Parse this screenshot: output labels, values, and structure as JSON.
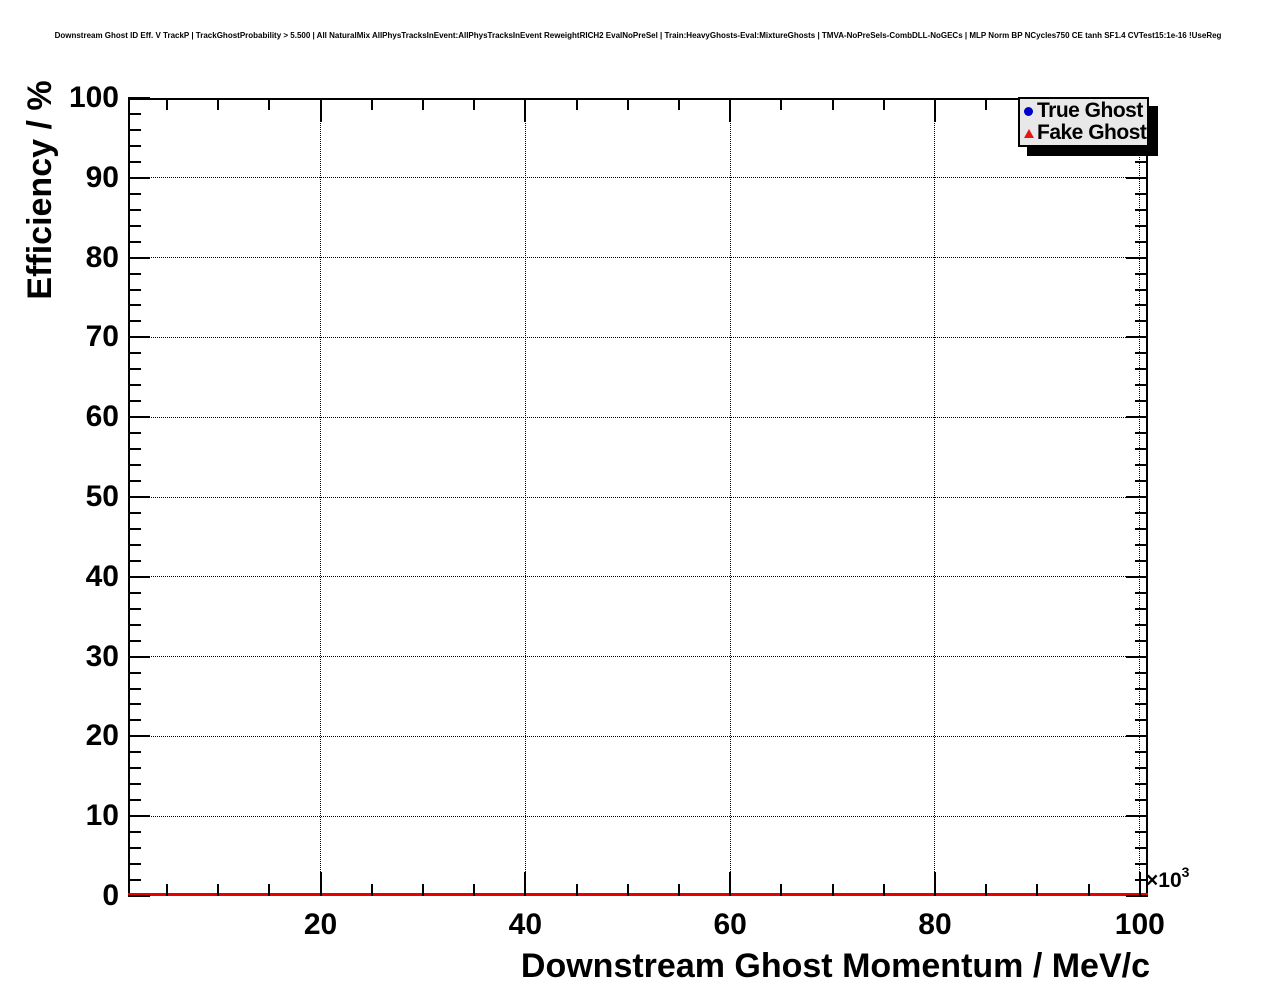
{
  "chart_data": {
    "type": "scatter",
    "title": "Downstream Ghost ID Eff. V TrackP | TrackGhostProbability > 5.500 | All NaturalMix AllPhysTracksInEvent:AllPhysTracksInEvent ReweightRICH2 EvalNoPreSel | Train:HeavyGhosts-Eval:MixtureGhosts | TMVA-NoPreSels-CombDLL-NoGECs | MLP Norm BP NCycles750 CE tanh SF1.4 CVTest15:1e-16 !UseReg",
    "xlabel": "Downstream Ghost Momentum / MeV/c",
    "ylabel": "Efficiency / %",
    "x_multiplier_base": "×10",
    "x_multiplier_exp": "3",
    "xlim": [
      1.2,
      100.8
    ],
    "ylim": [
      0,
      100
    ],
    "x_major_ticks": [
      20,
      40,
      60,
      80,
      100
    ],
    "x_minor_tick_step": 5,
    "y_major_ticks": [
      0,
      10,
      20,
      30,
      40,
      50,
      60,
      70,
      80,
      90,
      100
    ],
    "y_minor_tick_step": 2,
    "grid": {
      "style": "dotted",
      "color": "#000000",
      "at_major_ticks": true
    },
    "frame_color": "#000000",
    "background_color": "#ffffff",
    "legend": {
      "position": "top-right",
      "fill_color": "#e8e8e8",
      "border_color": "#000000",
      "shadow": true,
      "entries": [
        {
          "label": "True Ghost",
          "marker": "circle",
          "color": "#0000cc"
        },
        {
          "label": "Fake Ghost",
          "marker": "triangle",
          "color": "#e61717"
        }
      ]
    },
    "series": [
      {
        "name": "True Ghost",
        "marker": "circle",
        "color": "#0000cc",
        "visible_points": []
      },
      {
        "name": "Fake Ghost",
        "marker": "triangle",
        "color": "#e61717",
        "visible_points": [],
        "flat_line": {
          "y": 0,
          "x_from": 1.2,
          "x_to": 100.8,
          "color": "#e60000"
        }
      }
    ]
  }
}
